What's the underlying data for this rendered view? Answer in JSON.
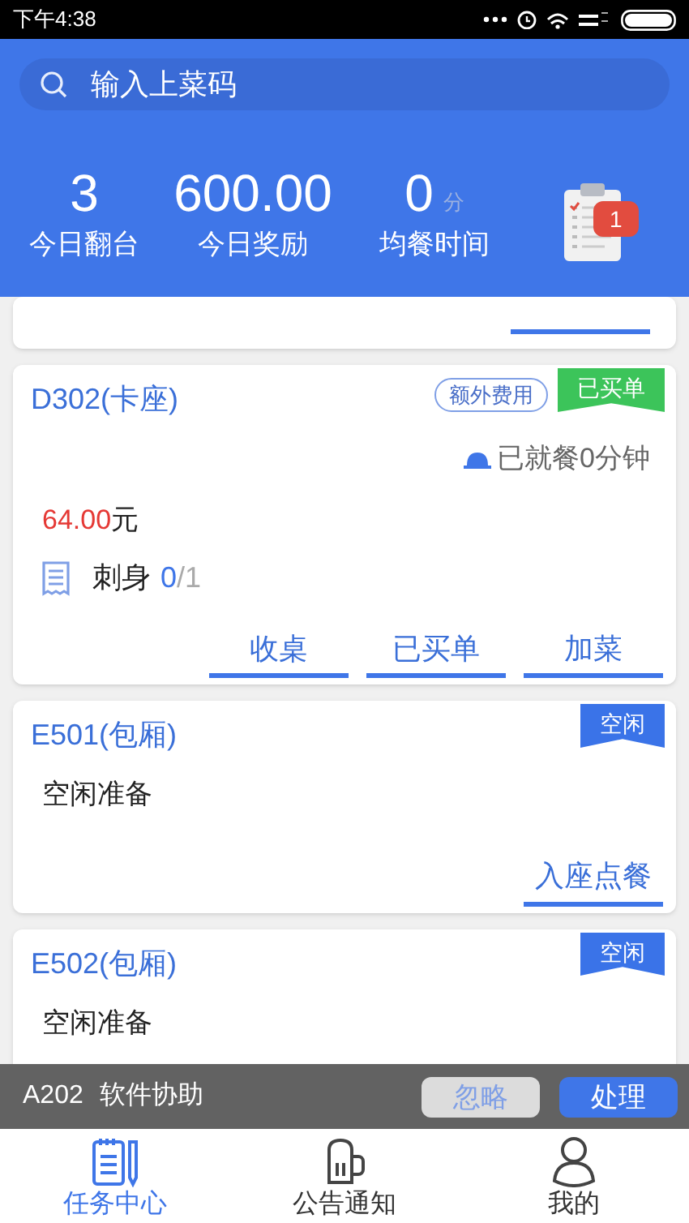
{
  "status_bar": {
    "time": "下午4:38"
  },
  "search": {
    "placeholder": "输入上菜码"
  },
  "stats": [
    {
      "value": "3",
      "label": "今日翻台"
    },
    {
      "value": "600.00",
      "label": "今日奖励"
    },
    {
      "value": "0",
      "unit": "分",
      "label": "均餐时间"
    }
  ],
  "task_badge": "1",
  "tables": [
    {
      "kind": "partial"
    },
    {
      "name": "D302(卡座)",
      "tag": "额外费用",
      "status": {
        "label": "已买单",
        "color": "#3cc45a"
      },
      "dining": "已就餐0分钟",
      "amount": "64.00",
      "currency": "元",
      "dishes": [
        {
          "name": "刺身",
          "served": "0",
          "total": "/1"
        }
      ],
      "actions": [
        "收桌",
        "已买单",
        "加菜"
      ]
    },
    {
      "name": "E501(包厢)",
      "status": {
        "label": "空闲",
        "color": "#3a73e8"
      },
      "note": "空闲准备",
      "actions": [
        "入座点餐"
      ]
    },
    {
      "name": "E502(包厢)",
      "status": {
        "label": "空闲",
        "color": "#3a73e8"
      },
      "note": "空闲准备"
    }
  ],
  "notice": {
    "table": "A202",
    "text": "软件协助",
    "buttons": [
      {
        "label": "忽略",
        "kind": "secondary"
      },
      {
        "label": "处理",
        "kind": "primary"
      }
    ]
  },
  "nav": [
    {
      "label": "任务中心",
      "selected": true
    },
    {
      "label": "公告通知",
      "selected": false
    },
    {
      "label": "我的",
      "selected": false
    }
  ]
}
